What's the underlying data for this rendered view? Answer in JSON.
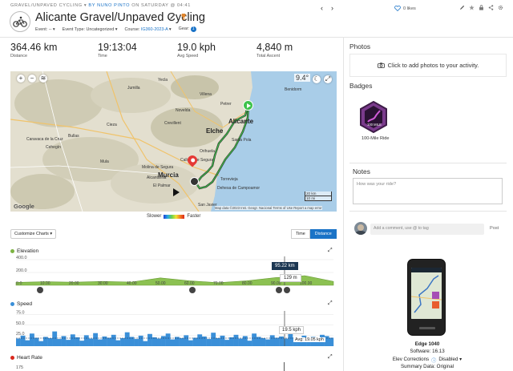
{
  "header": {
    "breadcrumb_category": "GRAVEL/UNPAVED CYCLING",
    "breadcrumb_by": "BY NUNO PINTO",
    "breadcrumb_when": "ON SATURDAY @ 04:41",
    "title": "Alicante Gravel/Unpaved Cycling",
    "event_label": "Event: --",
    "event_type_label": "Event Type: Uncategorized",
    "course_label": "Course:",
    "course_value": "IG360-2023-A",
    "gear_label": "Gear:",
    "gear_count": "1",
    "likes": "0 likes"
  },
  "stats": [
    {
      "value": "364.46 km",
      "label": "Distance"
    },
    {
      "value": "19:13:04",
      "label": "Time"
    },
    {
      "value": "19.0 kph",
      "label": "Avg Speed"
    },
    {
      "value": "4,840 m",
      "label": "Total Ascent"
    }
  ],
  "map": {
    "weather": "9.4°",
    "cities": [
      "Novelda",
      "Alicante",
      "Elche",
      "Santa Pola",
      "Crevillent",
      "Murcia",
      "Molina de Segura",
      "Orihuela",
      "Alcantarilla",
      "El Palmar",
      "Torrevieja",
      "Dehesa de Campoamor",
      "San Javier",
      "Yecla",
      "Villena",
      "Petrer",
      "Callosa de Segura",
      "Bullas",
      "Mula",
      "Cieza",
      "Caravaca de la Cruz",
      "Cehegín",
      "Jumilla",
      "Benidorm"
    ],
    "scale_km": "20 km",
    "scale_mi": "10 mi",
    "attribution": "Map data ©2023 Inst. Geogr. Nacional   Terms of Use   Report a map error",
    "google": "Google",
    "legend_slower": "Slower",
    "legend_faster": "Faster"
  },
  "controls": {
    "customize_charts": "Customize Charts ▾",
    "time": "Time",
    "distance": "Distance"
  },
  "elevation": {
    "title": "Elevation",
    "y_ticks": [
      "400.0",
      "200.0",
      "0.0"
    ],
    "x_ticks": [
      "10.00",
      "20.00",
      "30.00",
      "40.00",
      "50.00",
      "60.00",
      "70.00",
      "80.00",
      "90.00",
      "100.00"
    ],
    "tooltip_distance": "95.22 km",
    "tooltip_value": "129 m",
    "color": "#7cb342"
  },
  "speed": {
    "title": "Speed",
    "y_ticks": [
      "75.0",
      "50.0",
      "25.0"
    ],
    "tooltip_value": "19.5 kph",
    "avg_label": "Avg: 19.05 kph",
    "color": "#3a8fd8"
  },
  "heart_rate": {
    "title": "Heart Rate",
    "y_tick": "175",
    "color": "#d9281d"
  },
  "chart_data": [
    {
      "type": "area",
      "title": "Elevation",
      "xlabel": "",
      "ylabel": "",
      "ylim": [
        0,
        400
      ],
      "x": [
        0,
        10,
        20,
        30,
        40,
        50,
        60,
        70,
        80,
        90,
        95.22,
        100,
        110
      ],
      "values": [
        45,
        55,
        48,
        60,
        50,
        115,
        70,
        40,
        70,
        120,
        129,
        150,
        60
      ]
    },
    {
      "type": "area",
      "title": "Speed",
      "ylim": [
        0,
        80
      ],
      "avg": 19.05,
      "values": [
        18,
        25,
        14,
        30,
        20,
        12,
        22,
        19,
        35,
        17,
        24,
        15,
        28,
        21,
        13,
        26,
        18,
        31,
        16,
        23,
        20,
        27,
        14,
        19,
        33,
        22,
        17,
        25,
        12,
        29,
        21,
        18,
        24,
        30,
        16,
        22,
        19,
        26,
        14,
        20,
        28,
        23,
        17,
        32,
        19,
        25,
        15,
        21,
        27,
        18,
        24,
        13,
        30,
        22,
        19,
        16,
        26,
        20,
        23,
        18,
        29,
        21,
        15,
        25,
        19,
        22,
        17,
        27,
        24,
        20
      ]
    }
  ],
  "right": {
    "photos_title": "Photos",
    "photos_cta": "Click to add photos to your activity.",
    "badges_title": "Badges",
    "badge_name": "100-Mile Ride",
    "badge_text": "100 MILE",
    "notes_title": "Notes",
    "notes_placeholder": "How was your ride?",
    "comment_placeholder": "Add a comment, use @ to tag",
    "post": "Post",
    "device_name": "Edge 1040",
    "software": "Software: 16.13",
    "elev_corrections_label": "Elev Corrections",
    "elev_corrections_value": "Disabled ▾",
    "summary_data": "Summary Data: Original"
  }
}
